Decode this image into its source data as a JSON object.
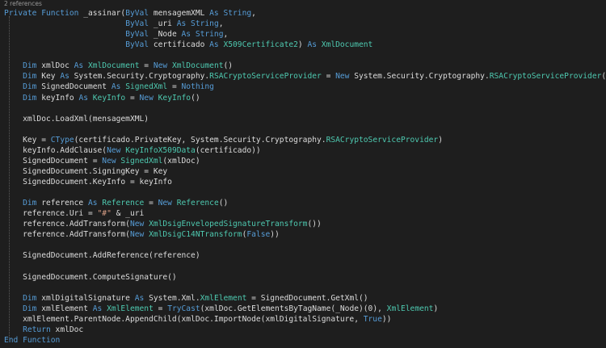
{
  "codelens": "2 references",
  "colors": {
    "background": "#1e1e1e",
    "keyword": "#569cd6",
    "type": "#4ec9b0",
    "string": "#d69d85",
    "plain": "#dcdcdc",
    "codelens": "#999999"
  },
  "lines": [
    [
      [
        "kw",
        "Private Function "
      ],
      [
        "pl",
        "_assinar("
      ],
      [
        "kw",
        "ByVal "
      ],
      [
        "pl",
        "mensagemXML "
      ],
      [
        "kw",
        "As String"
      ],
      [
        "pl",
        ","
      ]
    ],
    [
      [
        "pl",
        "                          "
      ],
      [
        "kw",
        "ByVal "
      ],
      [
        "pl",
        "_uri "
      ],
      [
        "kw",
        "As String"
      ],
      [
        "pl",
        ","
      ]
    ],
    [
      [
        "pl",
        "                          "
      ],
      [
        "kw",
        "ByVal "
      ],
      [
        "pl",
        "_Node "
      ],
      [
        "kw",
        "As String"
      ],
      [
        "pl",
        ","
      ]
    ],
    [
      [
        "pl",
        "                          "
      ],
      [
        "kw",
        "ByVal "
      ],
      [
        "pl",
        "certificado "
      ],
      [
        "kw",
        "As "
      ],
      [
        "ty",
        "X509Certificate2"
      ],
      [
        "pl",
        ") "
      ],
      [
        "kw",
        "As "
      ],
      [
        "ty",
        "XmlDocument"
      ]
    ],
    [],
    [
      [
        "pl",
        "    "
      ],
      [
        "kw",
        "Dim "
      ],
      [
        "pl",
        "xmlDoc "
      ],
      [
        "kw",
        "As "
      ],
      [
        "ty",
        "XmlDocument"
      ],
      [
        "pl",
        " = "
      ],
      [
        "kw",
        "New "
      ],
      [
        "ty",
        "XmlDocument"
      ],
      [
        "pl",
        "()"
      ]
    ],
    [
      [
        "pl",
        "    "
      ],
      [
        "kw",
        "Dim "
      ],
      [
        "pl",
        "Key "
      ],
      [
        "kw",
        "As "
      ],
      [
        "pl",
        "System.Security.Cryptography."
      ],
      [
        "ty",
        "RSACryptoServiceProvider"
      ],
      [
        "pl",
        " = "
      ],
      [
        "kw",
        "New "
      ],
      [
        "pl",
        "System.Security.Cryptography."
      ],
      [
        "ty",
        "RSACryptoServiceProvider"
      ],
      [
        "pl",
        "()"
      ]
    ],
    [
      [
        "pl",
        "    "
      ],
      [
        "kw",
        "Dim "
      ],
      [
        "pl",
        "SignedDocument "
      ],
      [
        "kw",
        "As "
      ],
      [
        "ty",
        "SignedXml"
      ],
      [
        "pl",
        " = "
      ],
      [
        "kw",
        "Nothing"
      ]
    ],
    [
      [
        "pl",
        "    "
      ],
      [
        "kw",
        "Dim "
      ],
      [
        "pl",
        "keyInfo "
      ],
      [
        "kw",
        "As "
      ],
      [
        "ty",
        "KeyInfo"
      ],
      [
        "pl",
        " = "
      ],
      [
        "kw",
        "New "
      ],
      [
        "ty",
        "KeyInfo"
      ],
      [
        "pl",
        "()"
      ]
    ],
    [],
    [
      [
        "pl",
        "    xmlDoc.LoadXml(mensagemXML)"
      ]
    ],
    [],
    [
      [
        "pl",
        "    Key = "
      ],
      [
        "kw",
        "CType"
      ],
      [
        "pl",
        "(certificado.PrivateKey, System.Security.Cryptography."
      ],
      [
        "ty",
        "RSACryptoServiceProvider"
      ],
      [
        "pl",
        ")"
      ]
    ],
    [
      [
        "pl",
        "    keyInfo.AddClause("
      ],
      [
        "kw",
        "New "
      ],
      [
        "ty",
        "KeyInfoX509Data"
      ],
      [
        "pl",
        "(certificado))"
      ]
    ],
    [
      [
        "pl",
        "    SignedDocument = "
      ],
      [
        "kw",
        "New "
      ],
      [
        "ty",
        "SignedXml"
      ],
      [
        "pl",
        "(xmlDoc)"
      ]
    ],
    [
      [
        "pl",
        "    SignedDocument.SigningKey = Key"
      ]
    ],
    [
      [
        "pl",
        "    SignedDocument.KeyInfo = keyInfo"
      ]
    ],
    [],
    [
      [
        "pl",
        "    "
      ],
      [
        "kw",
        "Dim "
      ],
      [
        "pl",
        "reference "
      ],
      [
        "kw",
        "As "
      ],
      [
        "ty",
        "Reference"
      ],
      [
        "pl",
        " = "
      ],
      [
        "kw",
        "New "
      ],
      [
        "ty",
        "Reference"
      ],
      [
        "pl",
        "()"
      ]
    ],
    [
      [
        "pl",
        "    reference.Uri = "
      ],
      [
        "st",
        "\"#\""
      ],
      [
        "pl",
        " & _uri"
      ]
    ],
    [
      [
        "pl",
        "    reference.AddTransform("
      ],
      [
        "kw",
        "New "
      ],
      [
        "ty",
        "XmlDsigEnvelopedSignatureTransform"
      ],
      [
        "pl",
        "())"
      ]
    ],
    [
      [
        "pl",
        "    reference.AddTransform("
      ],
      [
        "kw",
        "New "
      ],
      [
        "ty",
        "XmlDsigC14NTransform"
      ],
      [
        "pl",
        "("
      ],
      [
        "kw",
        "False"
      ],
      [
        "pl",
        "))"
      ]
    ],
    [],
    [
      [
        "pl",
        "    SignedDocument.AddReference(reference)"
      ]
    ],
    [],
    [
      [
        "pl",
        "    SignedDocument.ComputeSignature()"
      ]
    ],
    [],
    [
      [
        "pl",
        "    "
      ],
      [
        "kw",
        "Dim "
      ],
      [
        "pl",
        "xmlDigitalSignature "
      ],
      [
        "kw",
        "As "
      ],
      [
        "pl",
        "System.Xml."
      ],
      [
        "ty",
        "XmlElement"
      ],
      [
        "pl",
        " = SignedDocument.GetXml()"
      ]
    ],
    [
      [
        "pl",
        "    "
      ],
      [
        "kw",
        "Dim "
      ],
      [
        "pl",
        "xmlElement "
      ],
      [
        "kw",
        "As "
      ],
      [
        "ty",
        "XmlElement"
      ],
      [
        "pl",
        " = "
      ],
      [
        "kw",
        "TryCast"
      ],
      [
        "pl",
        "(xmlDoc.GetElementsByTagName(_Node)(0), "
      ],
      [
        "ty",
        "XmlElement"
      ],
      [
        "pl",
        ")"
      ]
    ],
    [
      [
        "pl",
        "    xmlElement.ParentNode.AppendChild(xmlDoc.ImportNode(xmlDigitalSignature, "
      ],
      [
        "kw",
        "True"
      ],
      [
        "pl",
        "))"
      ]
    ],
    [
      [
        "pl",
        "    "
      ],
      [
        "kw",
        "Return "
      ],
      [
        "pl",
        "xmlDoc"
      ]
    ],
    [
      [
        "kw",
        "End Function"
      ]
    ]
  ]
}
